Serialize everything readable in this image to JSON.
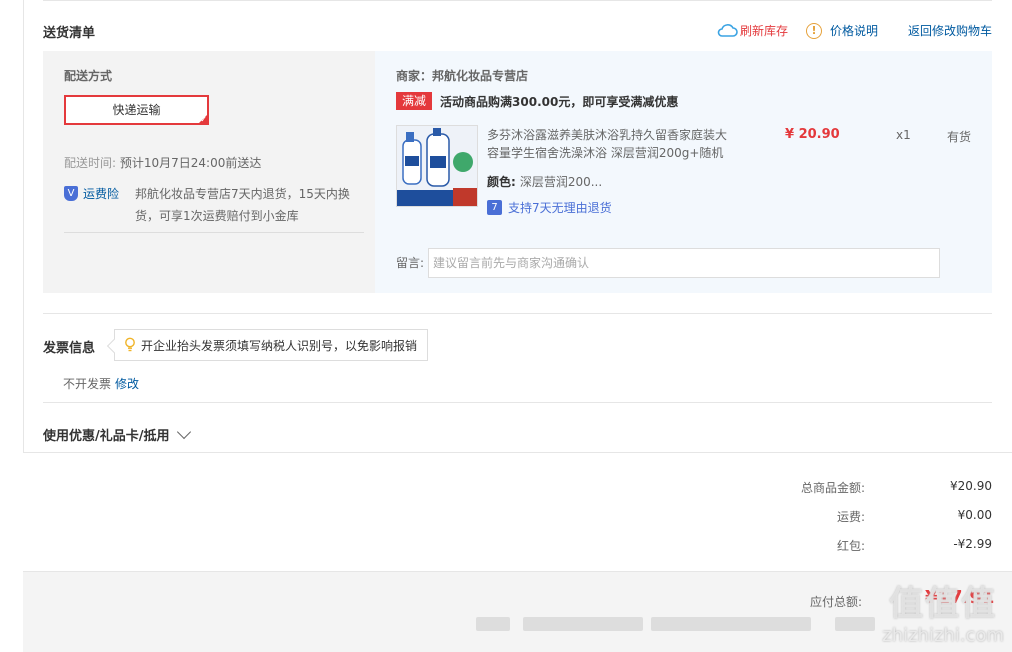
{
  "delivery": {
    "title": "送货清单",
    "refresh_label": "刷新库存",
    "price_note_label": "价格说明",
    "back_cart_label": "返回修改购物车",
    "shipping": {
      "label": "配送方式",
      "method": "快递运输",
      "time_label": "配送时间:",
      "time_value": "预计10月7日24:00前送达",
      "insurance_name": "运费险",
      "insurance_desc": "邦航化妆品专营店7天内退货，15天内换货，可享1次运费赔付到小金库"
    },
    "order": {
      "shop": "商家：邦航化妆品专营店",
      "promo_tag": "满减",
      "promo_text": "活动商品购满300.00元，即可享受满减优惠",
      "product_name": "多芬沐浴露滋养美肤沐浴乳持久留香家庭装大容量学生宿舍洗澡沐浴 深层营润200g+随机",
      "price": "¥ 20.90",
      "qty": "x1",
      "stock": "有货",
      "color_label": "颜色:",
      "color_value": "深层营润200...",
      "return_text": "支持7天无理由退货",
      "memo_label": "留言:",
      "memo_placeholder": "建议留言前先与商家沟通确认"
    }
  },
  "invoice": {
    "title": "发票信息",
    "tip": "开企业抬头发票须填写纳税人识别号，以免影响报销",
    "value": "不开发票",
    "edit": "修改"
  },
  "coupon": {
    "title": "使用优惠/礼品卡/抵用"
  },
  "summary": {
    "goods_label": "总商品金额:",
    "goods_value": "¥20.90",
    "shipping_label": "运费:",
    "shipping_value": "¥0.00",
    "redpacket_label": "红包:",
    "redpacket_value": "-¥2.99",
    "payable_label": "应付总额:",
    "payable_value": "¥17.91"
  },
  "watermark": {
    "big": "值值值",
    "small": "zhizhizhi.com"
  },
  "colors": {
    "accent_red": "#e4393c",
    "link_blue": "#005aa0"
  }
}
